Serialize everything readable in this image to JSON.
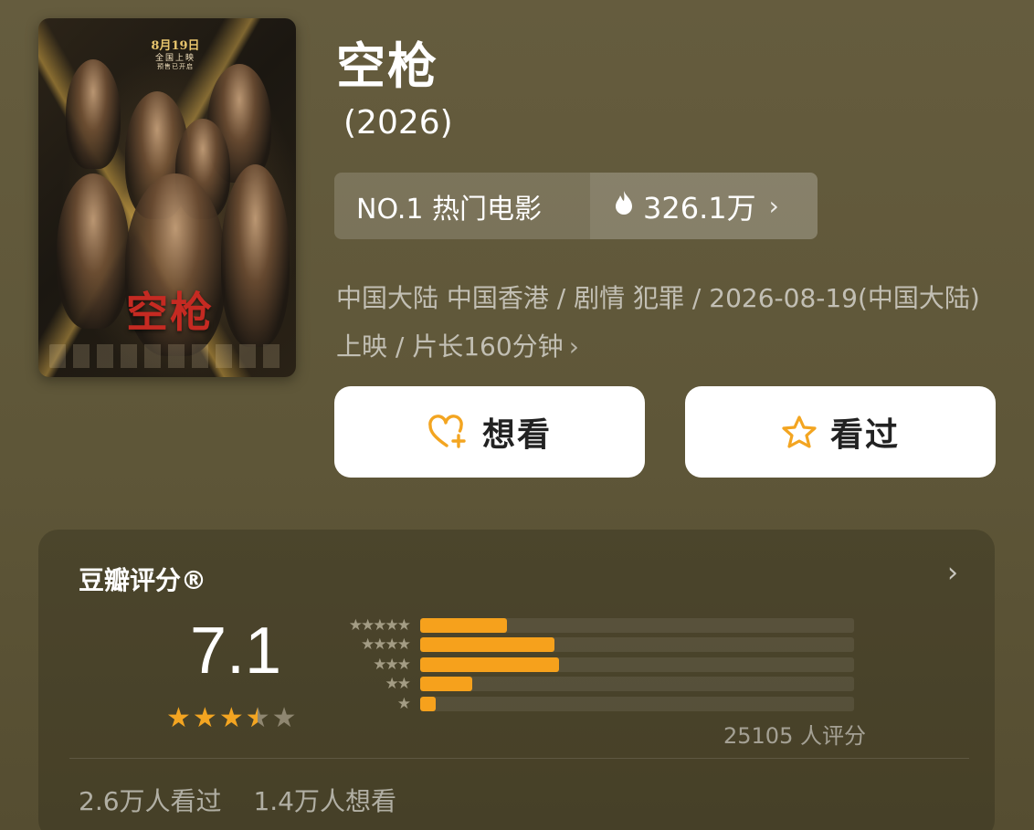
{
  "movie": {
    "title": "空枪",
    "year": "(2026)",
    "poster": {
      "date_line1": "8月19日",
      "date_line2": "全国上映",
      "date_line3": "预售已开启",
      "title_text": "空枪"
    }
  },
  "rank": {
    "label": "NO.1 热门电影",
    "heat": "326.1万",
    "flame_icon": "flame-icon",
    "chevron": "›"
  },
  "meta": {
    "text": "中国大陆 中国香港 / 剧情 犯罪 / 2026-08-19(中国大陆) 上映 / 片长160分钟",
    "chevron": "›"
  },
  "actions": {
    "want_label": "想看",
    "want_icon": "heart-plus-icon",
    "seen_label": "看过",
    "seen_icon": "star-outline-icon",
    "accent": "#f3a521"
  },
  "rating": {
    "title": "豆瓣评分®",
    "score": "7.1",
    "stars": {
      "value": 3.5,
      "max": 5
    },
    "distribution": [
      {
        "stars": 5,
        "icons": "★★★★★",
        "fraction": 0.2
      },
      {
        "stars": 4,
        "icons": "★★★★",
        "fraction": 0.31
      },
      {
        "stars": 3,
        "icons": "★★★",
        "fraction": 0.32
      },
      {
        "stars": 2,
        "icons": "★★",
        "fraction": 0.12
      },
      {
        "stars": 1,
        "icons": "★",
        "fraction": 0.035
      }
    ],
    "count_text": "25105 人评分",
    "bar_color": "#f6a11c"
  },
  "stats": {
    "seen": "2.6万人看过",
    "want": "1.4万人想看"
  }
}
